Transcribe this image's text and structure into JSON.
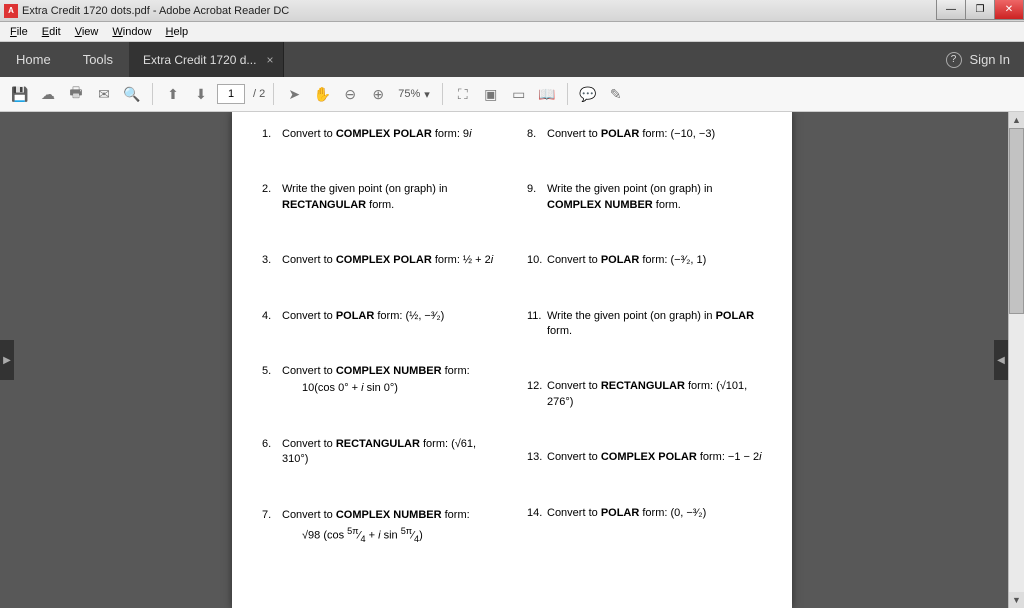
{
  "window": {
    "title": "Extra Credit 1720 dots.pdf - Adobe Acrobat Reader DC"
  },
  "menu": {
    "file": "File",
    "edit": "Edit",
    "view": "View",
    "window": "Window",
    "help": "Help"
  },
  "tabs": {
    "home": "Home",
    "tools": "Tools",
    "doc": "Extra Credit 1720 d...",
    "signin": "Sign In"
  },
  "toolbar": {
    "page_cur": "1",
    "page_total": "/ 2",
    "zoom": "75%"
  },
  "problems_left": [
    {
      "n": "1.",
      "html": "Convert to <b>COMPLEX POLAR</b> form: 9<i>i</i>"
    },
    {
      "n": "2.",
      "html": "Write the given point (on graph) in <b>RECTANGULAR</b> form."
    },
    {
      "n": "3.",
      "html": "Convert to <b>COMPLEX POLAR</b> form: ½ + 2<i>i</i>"
    },
    {
      "n": "4.",
      "html": "Convert to <b>POLAR</b> form: (½, −³⁄₂)"
    },
    {
      "n": "5.",
      "html": "Convert to <b>COMPLEX NUMBER</b> form:",
      "sub": "10(cos 0° + <i>i</i> sin 0°)"
    },
    {
      "n": "6.",
      "html": "Convert to <b>RECTANGULAR</b> form: (√61, 310°)"
    },
    {
      "n": "7.",
      "html": "Convert to <b>COMPLEX NUMBER</b> form:",
      "sub": "√98 (cos <sup>5π</sup>⁄<sub>4</sub> + <i>i</i> sin <sup>5π</sup>⁄<sub>4</sub>)"
    }
  ],
  "problems_right": [
    {
      "n": "8.",
      "html": "Convert to <b>POLAR</b> form: (−10, −3)"
    },
    {
      "n": "9.",
      "html": "Write the given point (on graph) in <b>COMPLEX NUMBER</b> form."
    },
    {
      "n": "10.",
      "html": "Convert to <b>POLAR</b> form: (−³⁄₂, 1)"
    },
    {
      "n": "11.",
      "html": "Write the given point (on graph) in <b>POLAR</b> form."
    },
    {
      "n": "12.",
      "html": "Convert to <b>RECTANGULAR</b> form: (√101, 276°)"
    },
    {
      "n": "13.",
      "html": "Convert to <b>COMPLEX POLAR</b> form: −1 − 2<i>i</i>"
    },
    {
      "n": "14.",
      "html": "Convert to <b>POLAR</b> form: (0, −³⁄₂)"
    }
  ]
}
